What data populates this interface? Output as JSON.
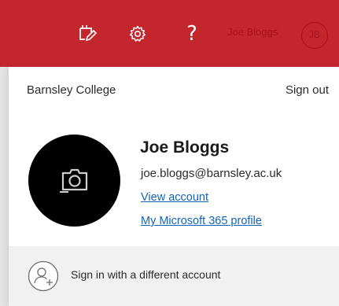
{
  "topbar": {
    "icons": [
      "feedback-icon",
      "gear-icon",
      "help-icon"
    ],
    "help_label": "?",
    "user_name": "Joe Bloggs",
    "user_initials": "JB",
    "bar_color": "#c4262e"
  },
  "account_panel": {
    "organization": "Barnsley College",
    "sign_out_label": "Sign out",
    "display_name": "Joe Bloggs",
    "email": "joe.bloggs@barnsley.ac.uk",
    "view_account_label": "View account",
    "profile_link_label": "My Microsoft 365 profile",
    "avatar_icon": "camera-icon"
  },
  "footer": {
    "icon": "add-person-icon",
    "label": "Sign in with a different account"
  }
}
